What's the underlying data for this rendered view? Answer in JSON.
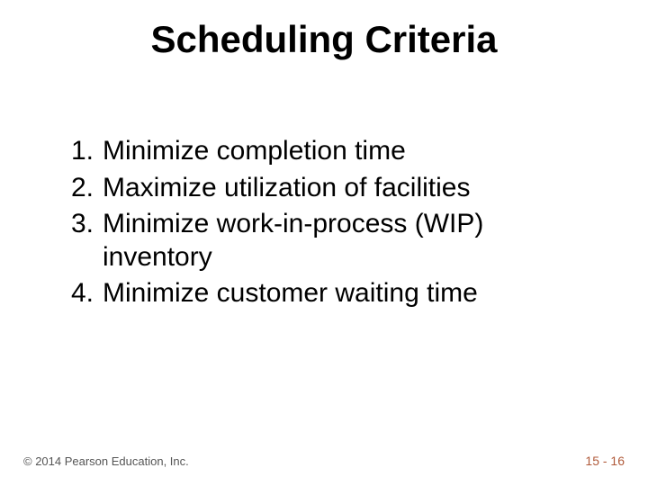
{
  "title": "Scheduling Criteria",
  "items": [
    {
      "num": "1.",
      "text": "Minimize completion time"
    },
    {
      "num": "2.",
      "text": "Maximize utilization of facilities"
    },
    {
      "num": "3.",
      "text": "Minimize work-in-process (WIP) inventory"
    },
    {
      "num": "4.",
      "text": "Minimize customer waiting time"
    }
  ],
  "footer": {
    "copyright": "© 2014 Pearson Education, Inc.",
    "page": "15 - 16"
  }
}
